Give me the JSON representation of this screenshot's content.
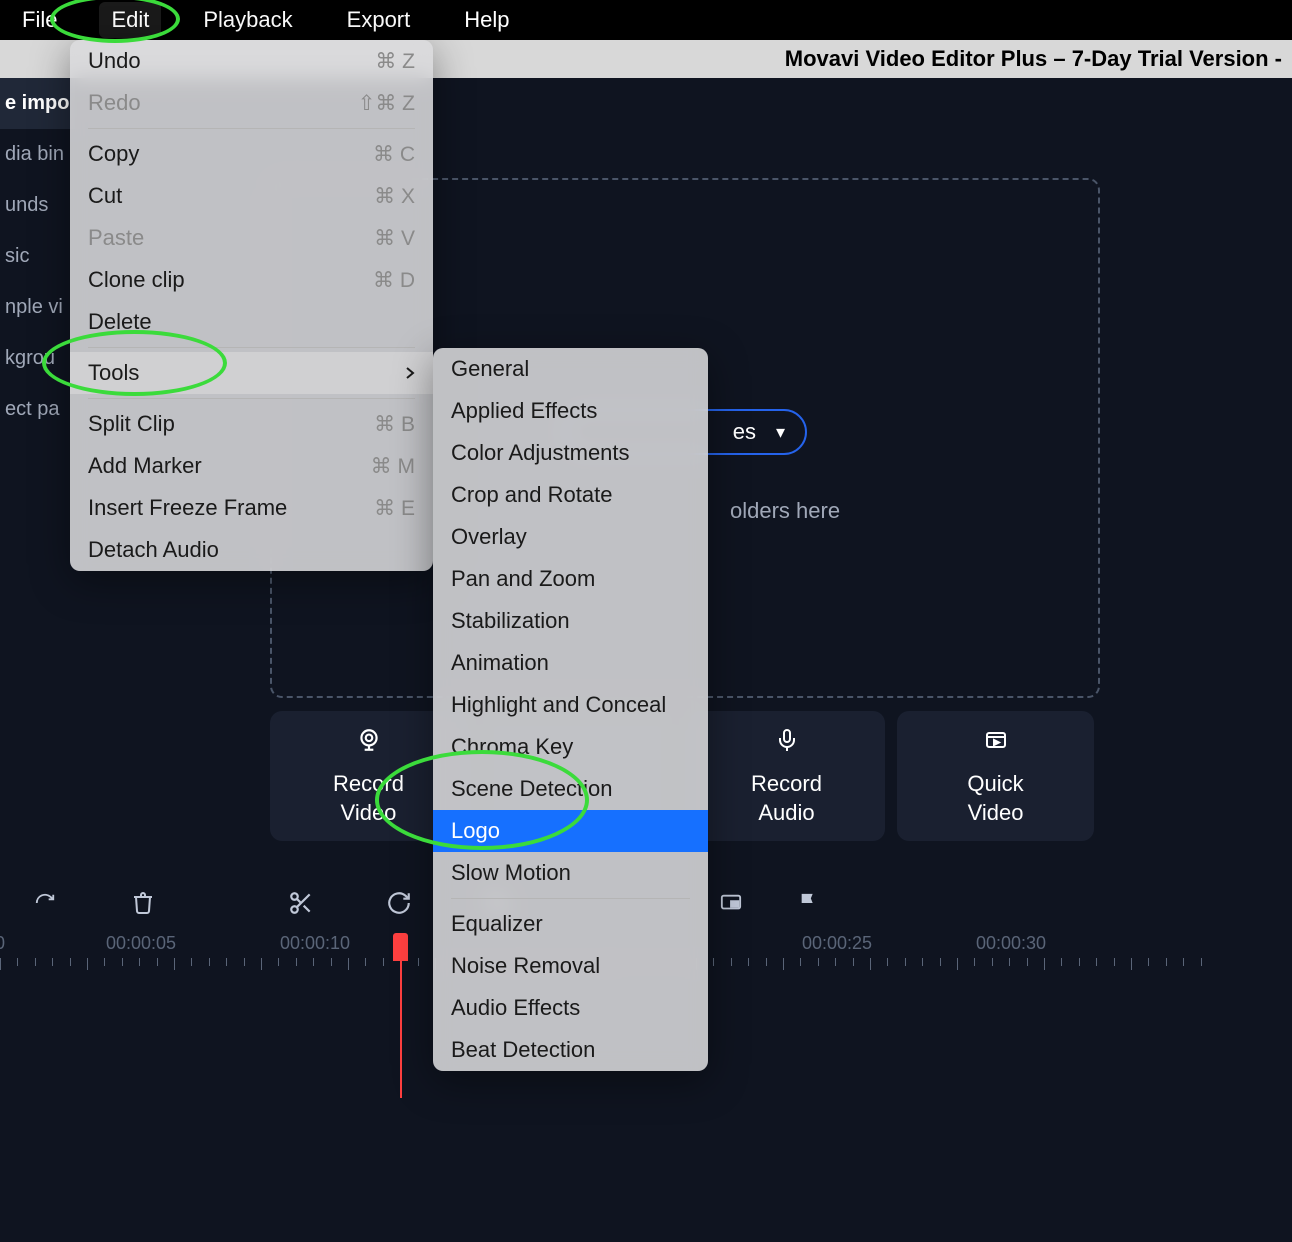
{
  "menubar": {
    "items": [
      "File",
      "Edit",
      "Playback",
      "Export",
      "Help"
    ]
  },
  "titlebar": {
    "text": "Movavi Video Editor Plus – 7-Day Trial Version -"
  },
  "sidebar": {
    "items": [
      "e impo",
      "dia bin",
      "unds",
      "sic",
      "nple vi",
      "kgrou",
      "ect pa"
    ]
  },
  "dropzone": {
    "hint": "olders here"
  },
  "addFilesButton": {
    "label": "es",
    "chevron": "▾"
  },
  "actionButtons": [
    {
      "label": "Record\nVideo",
      "icon": "webcam"
    },
    {
      "label": "",
      "icon": ""
    },
    {
      "label": "Record\nAudio",
      "icon": "mic"
    },
    {
      "label": "Quick\nVideo",
      "icon": "video"
    }
  ],
  "toolbar": {
    "icons": [
      "redo",
      "trash",
      "scissors",
      "rotate",
      "crop",
      "color",
      "mute",
      "pip",
      "flag"
    ]
  },
  "timeline": {
    "labels": [
      "0",
      "00:00:05",
      "00:00:10",
      "00:00:25",
      "00:00:30"
    ]
  },
  "editMenu": {
    "items": [
      {
        "label": "Undo",
        "shortcut": "⌘ Z",
        "enabled": true
      },
      {
        "label": "Redo",
        "shortcut": "⇧⌘ Z",
        "enabled": false
      },
      {
        "separator": true
      },
      {
        "label": "Copy",
        "shortcut": "⌘ C",
        "enabled": true
      },
      {
        "label": "Cut",
        "shortcut": "⌘ X",
        "enabled": true
      },
      {
        "label": "Paste",
        "shortcut": "⌘ V",
        "enabled": false
      },
      {
        "label": "Clone clip",
        "shortcut": "⌘ D",
        "enabled": true
      },
      {
        "label": "Delete",
        "shortcut": "",
        "enabled": true
      },
      {
        "separator": true
      },
      {
        "label": "Tools",
        "shortcut": "",
        "enabled": true,
        "submenu": true,
        "highlighted": true
      },
      {
        "separator": true
      },
      {
        "label": "Split Clip",
        "shortcut": "⌘ B",
        "enabled": true
      },
      {
        "label": "Add Marker",
        "shortcut": "⌘ M",
        "enabled": true
      },
      {
        "label": "Insert Freeze Frame",
        "shortcut": "⌘ E",
        "enabled": true
      },
      {
        "label": "Detach Audio",
        "shortcut": "",
        "enabled": true
      }
    ]
  },
  "toolsMenu": {
    "items": [
      {
        "label": "General"
      },
      {
        "label": "Applied Effects"
      },
      {
        "label": "Color Adjustments"
      },
      {
        "label": "Crop and Rotate"
      },
      {
        "label": "Overlay"
      },
      {
        "label": "Pan and Zoom"
      },
      {
        "label": "Stabilization"
      },
      {
        "label": "Animation"
      },
      {
        "label": "Highlight and Conceal"
      },
      {
        "label": "Chroma Key"
      },
      {
        "label": "Scene Detection"
      },
      {
        "label": "Logo",
        "selected": true
      },
      {
        "label": "Slow Motion"
      },
      {
        "separator": true
      },
      {
        "label": "Equalizer"
      },
      {
        "label": "Noise Removal"
      },
      {
        "label": "Audio Effects"
      },
      {
        "label": "Beat Detection"
      }
    ]
  }
}
